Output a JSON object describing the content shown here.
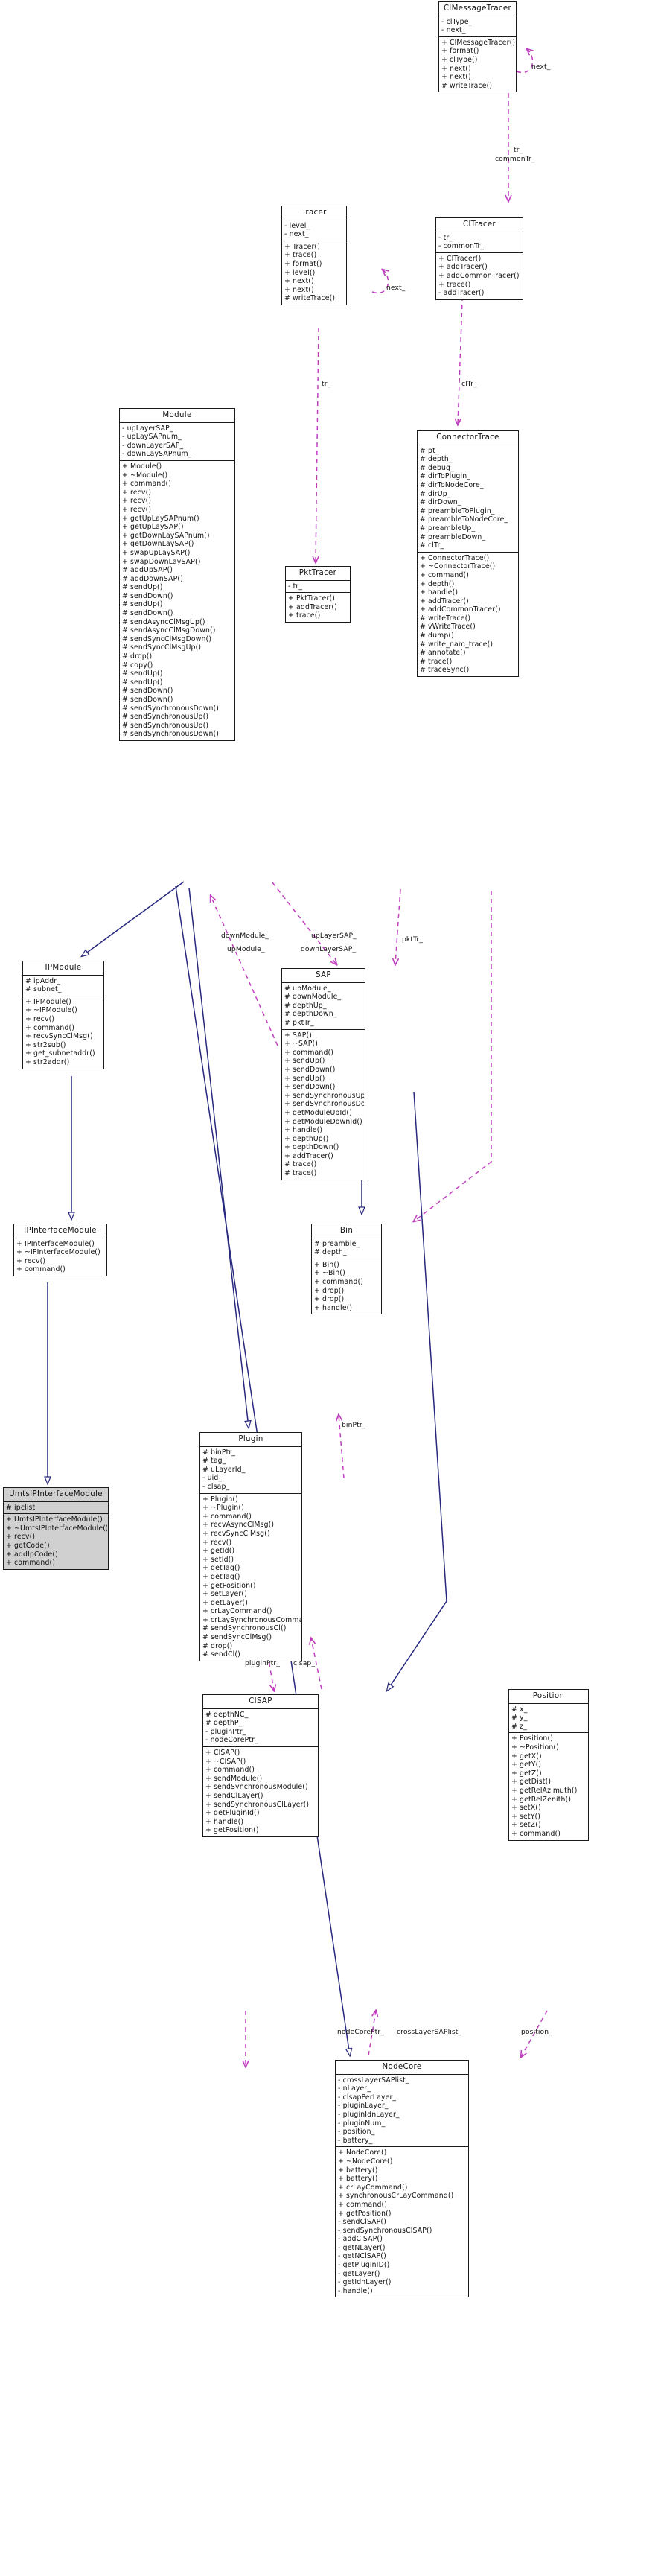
{
  "diagram": {
    "type": "uml-class-diagram",
    "colors": {
      "box_border": "#1a1a1a",
      "box_fill": "#ffffff",
      "highlight_fill": "#d0d0d0",
      "inheritance_edge": "#27287e",
      "association_edge": "#bf3fbf",
      "text": "#101010"
    }
  },
  "classes": {
    "ClMessageTracer": {
      "name": "ClMessageTracer",
      "attributes": [
        "- clType_",
        "- next_"
      ],
      "operations": [
        "+ ClMessageTracer()",
        "+ format()",
        "+ clType()",
        "+ next()",
        "+ next()",
        "# writeTrace()"
      ]
    },
    "Tracer": {
      "name": "Tracer",
      "attributes": [
        "- level_",
        "- next_"
      ],
      "operations": [
        "+ Tracer()",
        "+ trace()",
        "+ format()",
        "+ level()",
        "+ next()",
        "+ next()",
        "# writeTrace()"
      ]
    },
    "ClTracer": {
      "name": "ClTracer",
      "attributes": [
        "- tr_",
        "- commonTr_"
      ],
      "operations": [
        "+ ClTracer()",
        "+ addTracer()",
        "+ addCommonTracer()",
        "+ trace()",
        "- addTracer()"
      ]
    },
    "Module": {
      "name": "Module",
      "attributes": [
        "- upLayerSAP_",
        "- upLaySAPnum_",
        "- downLayerSAP_",
        "- downLaySAPnum_"
      ],
      "operations": [
        "+ Module()",
        "+ ~Module()",
        "+ command()",
        "+ recv()",
        "+ recv()",
        "+ recv()",
        "+ getUpLaySAPnum()",
        "+ getUpLaySAP()",
        "+ getDownLaySAPnum()",
        "+ getDownLaySAP()",
        "+ swapUpLaySAP()",
        "+ swapDownLaySAP()",
        "# addUpSAP()",
        "# addDownSAP()",
        "# sendUp()",
        "# sendDown()",
        "# sendUp()",
        "# sendDown()",
        "# sendAsyncClMsgUp()",
        "# sendAsyncClMsgDown()",
        "# sendSyncClMsgDown()",
        "# sendSyncClMsgUp()",
        "# drop()",
        "# copy()",
        "# sendUp()",
        "# sendUp()",
        "# sendDown()",
        "# sendDown()",
        "# sendSynchronousDown()",
        "# sendSynchronousUp()",
        "# sendSynchronousUp()",
        "# sendSynchronousDown()"
      ]
    },
    "PktTracer": {
      "name": "PktTracer",
      "attributes": [
        "- tr_"
      ],
      "operations": [
        "+ PktTracer()",
        "+ addTracer()",
        "+ trace()"
      ]
    },
    "ConnectorTrace": {
      "name": "ConnectorTrace",
      "attributes": [
        "# pt_",
        "# depth_",
        "# debug_",
        "# dirToPlugin_",
        "# dirToNodeCore_",
        "# dirUp_",
        "# dirDown_",
        "# preambleToPlugin_",
        "# preambleToNodeCore_",
        "# preambleUp_",
        "# preambleDown_",
        "# clTr_"
      ],
      "operations": [
        "+ ConnectorTrace()",
        "+ ~ConnectorTrace()",
        "+ command()",
        "+ depth()",
        "+ handle()",
        "+ addTracer()",
        "+ addCommonTracer()",
        "# writeTrace()",
        "# vWriteTrace()",
        "# dump()",
        "# write_nam_trace()",
        "# annotate()",
        "# trace()",
        "# traceSync()"
      ]
    },
    "IPModule": {
      "name": "IPModule",
      "attributes": [
        "# ipAddr_",
        "# subnet_"
      ],
      "operations": [
        "+ IPModule()",
        "+ ~IPModule()",
        "+ recv()",
        "+ command()",
        "+ recvSyncClMsg()",
        "+ str2sub()",
        "+ get_subnetaddr()",
        "+ str2addr()"
      ]
    },
    "SAP": {
      "name": "SAP",
      "attributes": [
        "# upModule_",
        "# downModule_",
        "# depthUp_",
        "# depthDown_",
        "# pktTr_"
      ],
      "operations": [
        "+ SAP()",
        "+ ~SAP()",
        "+ command()",
        "+ sendUp()",
        "+ sendDown()",
        "+ sendUp()",
        "+ sendDown()",
        "+ sendSynchronousUp()",
        "+ sendSynchronousDown()",
        "+ getModuleUpId()",
        "+ getModuleDownId()",
        "+ handle()",
        "+ depthUp()",
        "+ depthDown()",
        "+ addTracer()",
        "# trace()",
        "# trace()"
      ]
    },
    "Bin": {
      "name": "Bin",
      "attributes": [
        "# preamble_",
        "# depth_"
      ],
      "operations": [
        "+ Bin()",
        "+ ~Bin()",
        "+ command()",
        "+ drop()",
        "+ drop()",
        "+ handle()"
      ]
    },
    "IPInterfaceModule": {
      "name": "IPInterfaceModule",
      "attributes": [],
      "operations": [
        "+ IPInterfaceModule()",
        "+ ~IPInterfaceModule()",
        "+ recv()",
        "+ command()"
      ]
    },
    "Plugin": {
      "name": "Plugin",
      "attributes": [
        "# binPtr_",
        "# tag_",
        "# uLayerId_",
        "- uid_",
        "- clsap_"
      ],
      "operations": [
        "+ Plugin()",
        "+ ~Plugin()",
        "+ command()",
        "+ recvAsyncClMsg()",
        "+ recvSyncClMsg()",
        "+ recv()",
        "+ getId()",
        "+ setId()",
        "+ getTag()",
        "+ getTag()",
        "+ getPosition()",
        "+ setLayer()",
        "+ getLayer()",
        "+ crLayCommand()",
        "+ crLaySynchronousCommand()",
        "# sendSynchronousCl()",
        "# sendSyncClMsg()",
        "# drop()",
        "# sendCl()"
      ]
    },
    "UmtsIPInterfaceModule": {
      "name": "UmtsIPInterfaceModule",
      "attributes": [
        "# ipclist"
      ],
      "operations": [
        "+ UmtsIPInterfaceModule()",
        "+ ~UmtsIPInterfaceModule()",
        "+ recv()",
        "+ getCode()",
        "+ addIpCode()",
        "+ command()"
      ]
    },
    "ClSAP": {
      "name": "ClSAP",
      "attributes": [
        "# depthNC_",
        "# depthP_",
        "- pluginPtr_",
        "- nodeCorePtr_"
      ],
      "operations": [
        "+ ClSAP()",
        "+ ~ClSAP()",
        "+ command()",
        "+ sendModule()",
        "+ sendSynchronousModule()",
        "+ sendClLayer()",
        "+ sendSynchronousClLayer()",
        "+ getPluginId()",
        "+ handle()",
        "+ getPosition()"
      ]
    },
    "Position": {
      "name": "Position",
      "attributes": [
        "# x_",
        "# y_",
        "# z_"
      ],
      "operations": [
        "+ Position()",
        "+ ~Position()",
        "+ getX()",
        "+ getY()",
        "+ getZ()",
        "+ getDist()",
        "+ getRelAzimuth()",
        "+ getRelZenith()",
        "+ setX()",
        "+ setY()",
        "+ setZ()",
        "+ command()"
      ]
    },
    "NodeCore": {
      "name": "NodeCore",
      "attributes": [
        "- crossLayerSAPlist_",
        "- nLayer_",
        "- clsapPerLayer_",
        "- pluginLayer_",
        "- pluginIdnLayer_",
        "- pluginNum_",
        "- position_",
        "- battery_"
      ],
      "operations": [
        "+ NodeCore()",
        "+ ~NodeCore()",
        "+ battery()",
        "+ battery()",
        "+ crLayCommand()",
        "+ synchronousCrLayCommand()",
        "+ command()",
        "+ getPosition()",
        "- sendClSAP()",
        "- sendSynchronousClSAP()",
        "- addClSAP()",
        "- getNLayer()",
        "- getNClSAP()",
        "- getPluginID()",
        "- getLayer()",
        "- getIdnLayer()",
        "- handle()"
      ]
    }
  },
  "edge_labels": [
    {
      "text": "next_",
      "id": "next-clmessagetracer"
    },
    {
      "text": "next_",
      "id": "next-tracer"
    },
    {
      "text": "tr_",
      "id": "tr-cltracer"
    },
    {
      "text": "commonTr_",
      "id": "commontr-cltracer"
    },
    {
      "text": "tr_",
      "id": "tr-tracer-pkttracer"
    },
    {
      "text": "clTr_",
      "id": "cltr-connectortrace"
    },
    {
      "text": "downModule_",
      "id": "downmodule-sap"
    },
    {
      "text": "upModule_",
      "id": "upmodule-sap"
    },
    {
      "text": "upLayerSAP_",
      "id": "uplayersap-module"
    },
    {
      "text": "downLayerSAP_",
      "id": "downlayersap-module"
    },
    {
      "text": "pktTr_",
      "id": "pkttr-sap"
    },
    {
      "text": "binPtr_",
      "id": "binptr-plugin"
    },
    {
      "text": "pluginPtr_",
      "id": "pluginptr-clsap"
    },
    {
      "text": "clsap_",
      "id": "clsap-plugin"
    },
    {
      "text": "nodeCorePtr_",
      "id": "nodecoreptr-clsap"
    },
    {
      "text": "crossLayerSAPlist_",
      "id": "crosslayersaplist-nodecore"
    },
    {
      "text": "position_",
      "id": "position-nodecore"
    }
  ]
}
